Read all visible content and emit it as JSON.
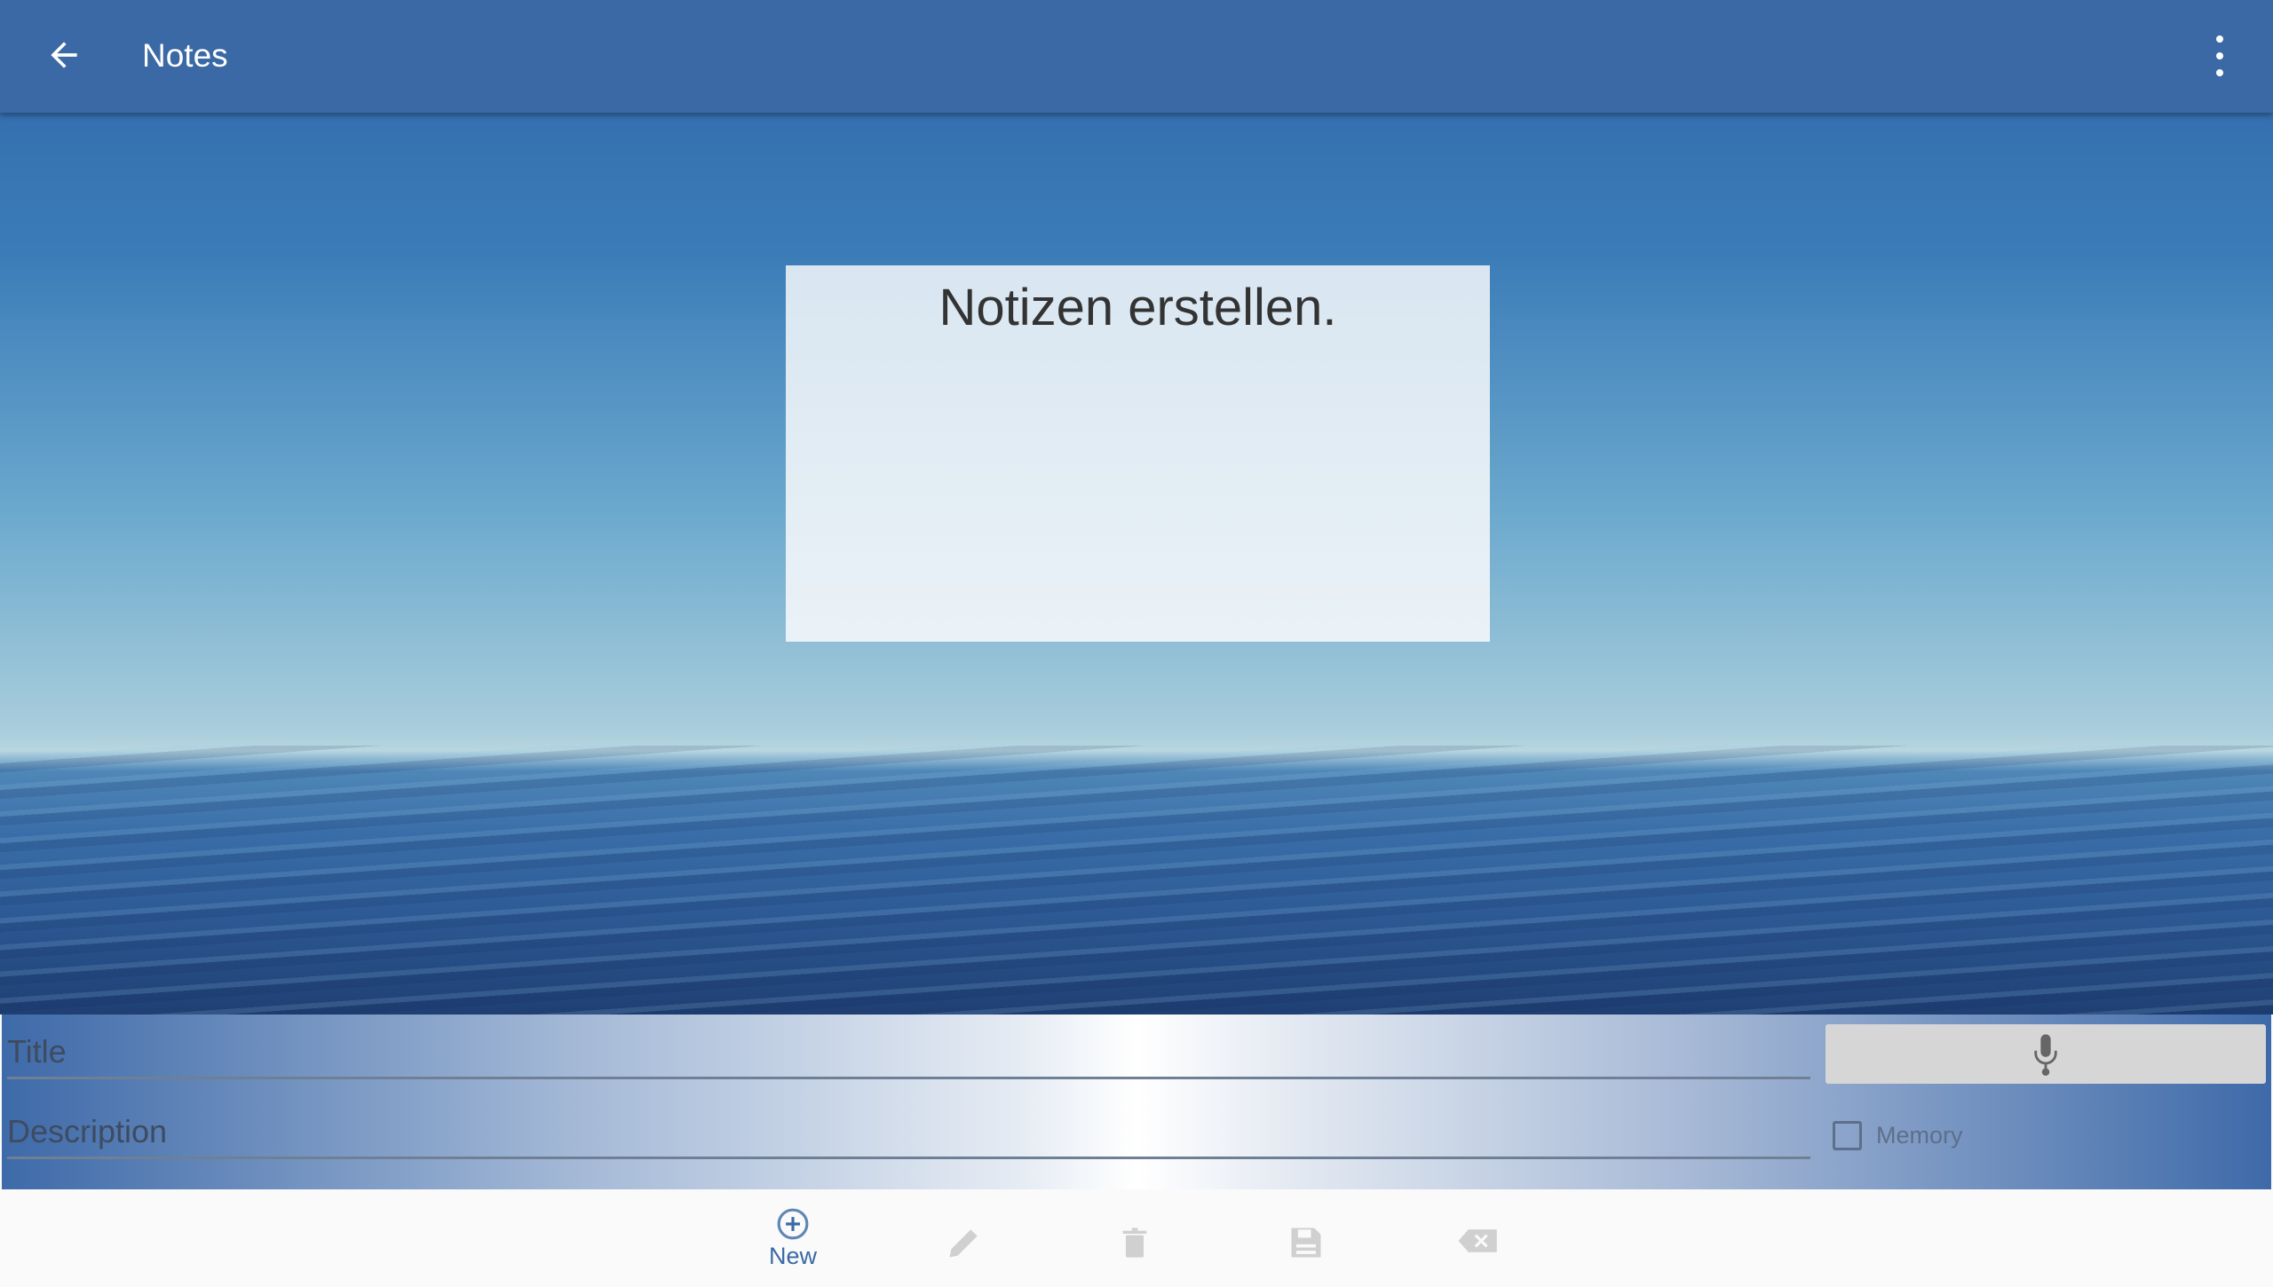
{
  "header": {
    "title": "Notes",
    "back_icon": "arrow-left-icon",
    "menu_icon": "more-vert-icon"
  },
  "note": {
    "text": "Notizen erstellen."
  },
  "form": {
    "title_placeholder": "Title",
    "description_placeholder": "Description",
    "memory_label": "Memory",
    "memory_checked": false,
    "mic_icon": "microphone-icon"
  },
  "toolbar": {
    "new_label": "New",
    "items": [
      "new",
      "edit",
      "delete",
      "save",
      "clear"
    ]
  },
  "colors": {
    "primary": "#3a69a5",
    "disabled": "#d0d0d0"
  }
}
